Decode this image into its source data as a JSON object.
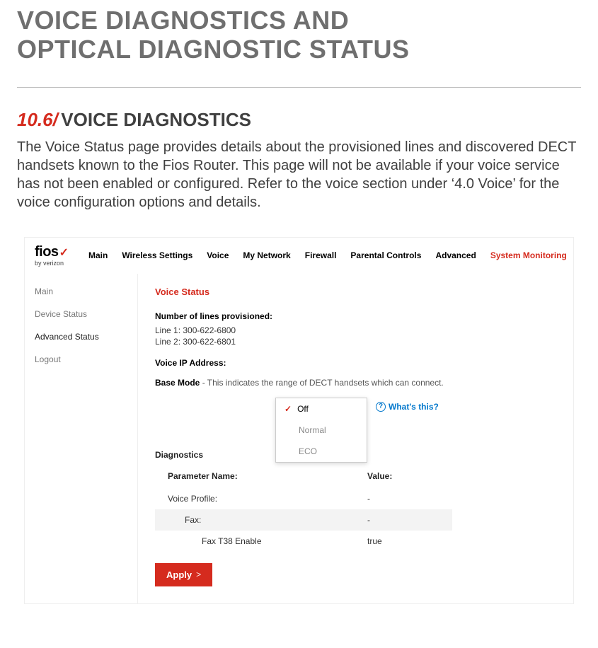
{
  "doc": {
    "heading_line1": "VOICE DIAGNOSTICS AND",
    "heading_line2": "OPTICAL DIAGNOSTIC STATUS",
    "section_number": "10.6/",
    "section_title": "VOICE DIAGNOSTICS",
    "body": "The Voice Status page provides details about the provisioned lines and discovered DECT handsets known to the Fios Router. This page will not be available if your voice service has not been enabled or configured. Refer to the voice section under ‘4.0 Voice’ for the voice configuration options and details."
  },
  "app": {
    "logo": {
      "brand": "fios",
      "sub": "by verizon"
    },
    "nav": {
      "items": [
        "Main",
        "Wireless Settings",
        "Voice",
        "My Network",
        "Firewall",
        "Parental Controls",
        "Advanced",
        "System Monitoring"
      ],
      "active_index": 7
    },
    "sidebar": {
      "items": [
        "Main",
        "Device Status",
        "Advanced Status",
        "Logout"
      ],
      "active_index": 2
    },
    "content": {
      "title": "Voice Status",
      "lines_label": "Number of lines provisioned:",
      "line1": "Line 1:  300-622-6800",
      "line2": "Line 2: 300-622-6801",
      "voice_ip_label": "Voice IP Address:",
      "base_mode_label": "Base Mode",
      "base_mode_desc": " - This indicates the range of DECT handsets which can connect.",
      "dropdown": {
        "options": [
          "Off",
          "Normal",
          "ECO"
        ],
        "selected_index": 0
      },
      "whats_this": "What's this?",
      "diagnostics_heading": "Diagnostics",
      "table": {
        "header": {
          "param": "Parameter Name:",
          "value": "Value:"
        },
        "rows": [
          {
            "param": "Voice Profile:",
            "value": "-",
            "indent": 0,
            "shade": false
          },
          {
            "param": "Fax:",
            "value": "-",
            "indent": 1,
            "shade": true
          },
          {
            "param": "Fax T38 Enable",
            "value": "true",
            "indent": 2,
            "shade": false
          }
        ]
      },
      "apply_label": "Apply"
    }
  }
}
